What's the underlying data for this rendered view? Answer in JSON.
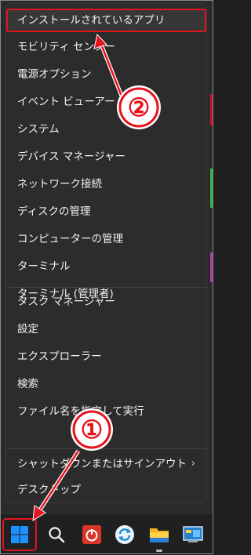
{
  "menu": {
    "items": [
      {
        "label": "インストールされているアプリ"
      },
      {
        "label": "モビリティ センター"
      },
      {
        "label": "電源オプション"
      },
      {
        "label": "イベント ビューアー"
      },
      {
        "label": "システム"
      },
      {
        "label": "デバイス マネージャー"
      },
      {
        "label": "ネットワーク接続"
      },
      {
        "label": "ディスクの管理"
      },
      {
        "label": "コンピューターの管理"
      },
      {
        "label": "ターミナル"
      },
      {
        "label": "ターミナル (管理者)"
      },
      {
        "label": "タスク マネージャー"
      },
      {
        "label": "設定"
      },
      {
        "label": "エクスプローラー"
      },
      {
        "label": "検索"
      },
      {
        "label": "ファイル名を指定して実行"
      },
      {
        "label": "シャットダウンまたはサインアウト"
      },
      {
        "label": "デスクトップ"
      }
    ],
    "submenu_chevron": "›"
  },
  "taskbar": {
    "icons": [
      "windows-start-icon",
      "search-icon",
      "power-app-icon",
      "sync-app-icon",
      "file-explorer-icon",
      "control-panel-icon"
    ]
  },
  "annotations": {
    "marker1": "①",
    "marker2": "②",
    "color": "#e5131e"
  }
}
